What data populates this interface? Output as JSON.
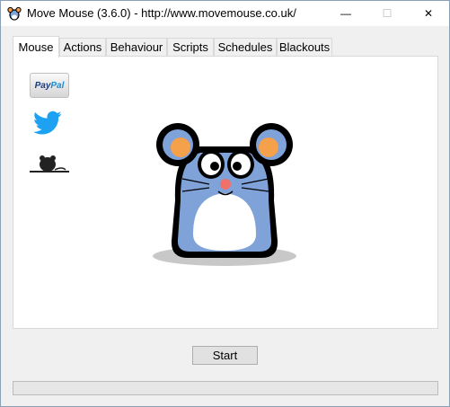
{
  "window": {
    "title": "Move Mouse (3.6.0) - http://www.movemouse.co.uk/",
    "minimize_glyph": "—",
    "maximize_glyph": "☐",
    "close_glyph": "✕"
  },
  "tabs": [
    {
      "label": "Mouse",
      "active": true
    },
    {
      "label": "Actions",
      "active": false
    },
    {
      "label": "Behaviour",
      "active": false
    },
    {
      "label": "Scripts",
      "active": false
    },
    {
      "label": "Schedules",
      "active": false
    },
    {
      "label": "Blackouts",
      "active": false
    }
  ],
  "mouse_tab": {
    "paypal_label_a": "Pay",
    "paypal_label_b": "Pal",
    "icons": [
      "paypal-icon",
      "twitter-icon",
      "mouse-icon"
    ]
  },
  "footer": {
    "start_label": "Start",
    "progress": 0
  },
  "colors": {
    "accent": "#1da1f2",
    "mascot_body": "#7fa3d9",
    "mascot_ear": "#f5a04a"
  }
}
